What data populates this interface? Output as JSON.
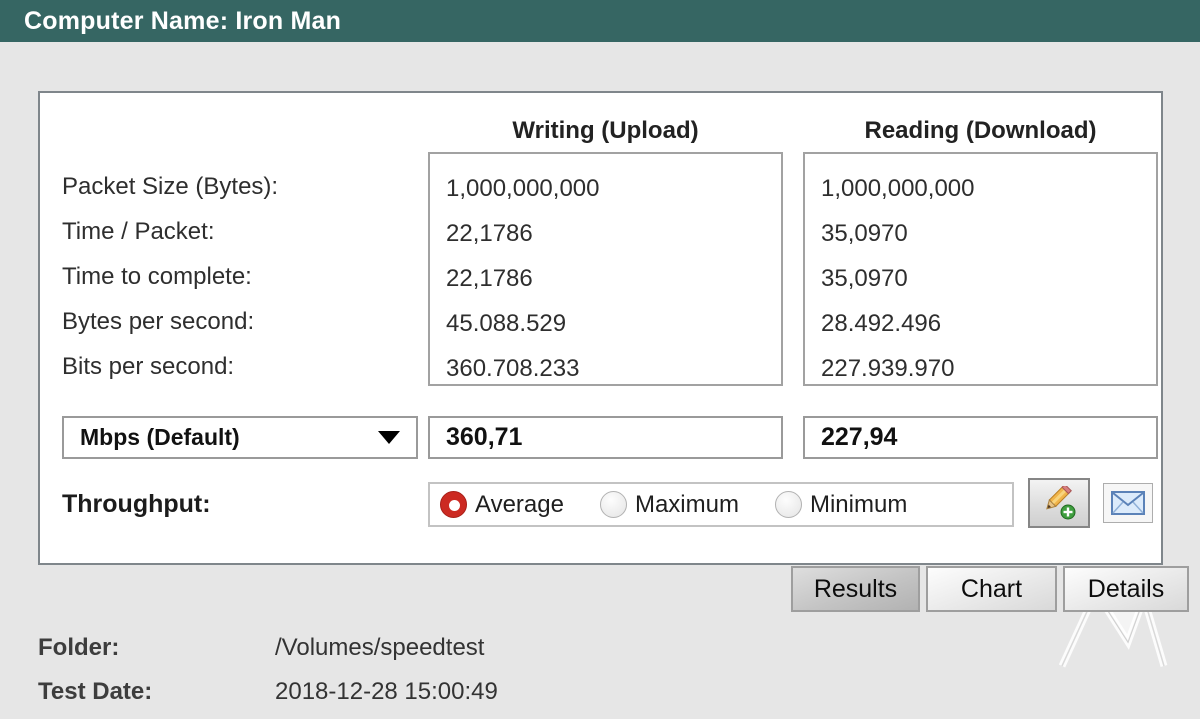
{
  "header": {
    "title": "Computer Name: Iron Man"
  },
  "table": {
    "col_writing": "Writing (Upload)",
    "col_reading": "Reading (Download)",
    "row_labels": [
      "Packet Size (Bytes):",
      "Time / Packet:",
      "Time to complete:",
      "Bytes per second:",
      "Bits per second:"
    ],
    "writing_values": [
      "1,000,000,000",
      "22,1786",
      "22,1786",
      "45.088.529",
      "360.708.233"
    ],
    "reading_values": [
      "1,000,000,000",
      "35,0970",
      "35,0970",
      "28.492.496",
      "227.939.970"
    ]
  },
  "speed_row": {
    "unit_selected": "Mbps (Default)",
    "writing_speed": "360,71",
    "reading_speed": "227,94"
  },
  "throughput": {
    "label": "Throughput:",
    "options": [
      {
        "label": "Average",
        "selected": true
      },
      {
        "label": "Maximum",
        "selected": false
      },
      {
        "label": "Minimum",
        "selected": false
      }
    ]
  },
  "icons": {
    "note_button": "edit-note-icon",
    "mail_button": "mail-icon"
  },
  "tabs": [
    {
      "label": "Results",
      "active": true
    },
    {
      "label": "Chart",
      "active": false
    },
    {
      "label": "Details",
      "active": false
    }
  ],
  "footer": {
    "folder_label": "Folder:",
    "folder_value": "/Volumes/speedtest",
    "date_label": "Test Date:",
    "date_value": "2018-12-28 15:00:49"
  },
  "colors": {
    "titlebar": "#366663",
    "radio_selected": "#cc2a22",
    "page_background": "#e6e6e6"
  }
}
